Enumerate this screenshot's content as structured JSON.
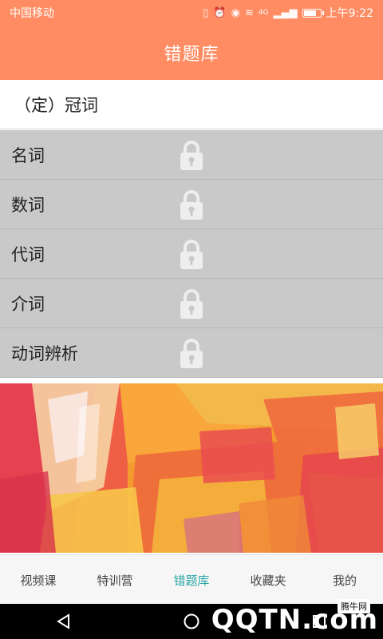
{
  "status_bar": {
    "carrier": "中国移动",
    "network": "4G",
    "time": "上午9:22",
    "battery_level": 0.7
  },
  "header": {
    "title": "错题库"
  },
  "active_item": {
    "label": "（定）冠词"
  },
  "locked_items": [
    {
      "label": "名词",
      "icon": "lock-icon"
    },
    {
      "label": "数词",
      "icon": "lock-icon"
    },
    {
      "label": "代词",
      "icon": "lock-icon"
    },
    {
      "label": "介词",
      "icon": "lock-icon"
    },
    {
      "label": "动词辨析",
      "icon": "lock-icon"
    }
  ],
  "tabs": [
    {
      "label": "视频课"
    },
    {
      "label": "特训营"
    },
    {
      "label": "错题库",
      "active": true
    },
    {
      "label": "收藏夹"
    },
    {
      "label": "我的"
    }
  ],
  "watermark": {
    "text": "QQTN.com",
    "badge": "腾牛网"
  },
  "colors": {
    "accent": "#ff8c63",
    "active_tab": "#2aa6a6",
    "locked_bg": "#c9c9c9"
  }
}
